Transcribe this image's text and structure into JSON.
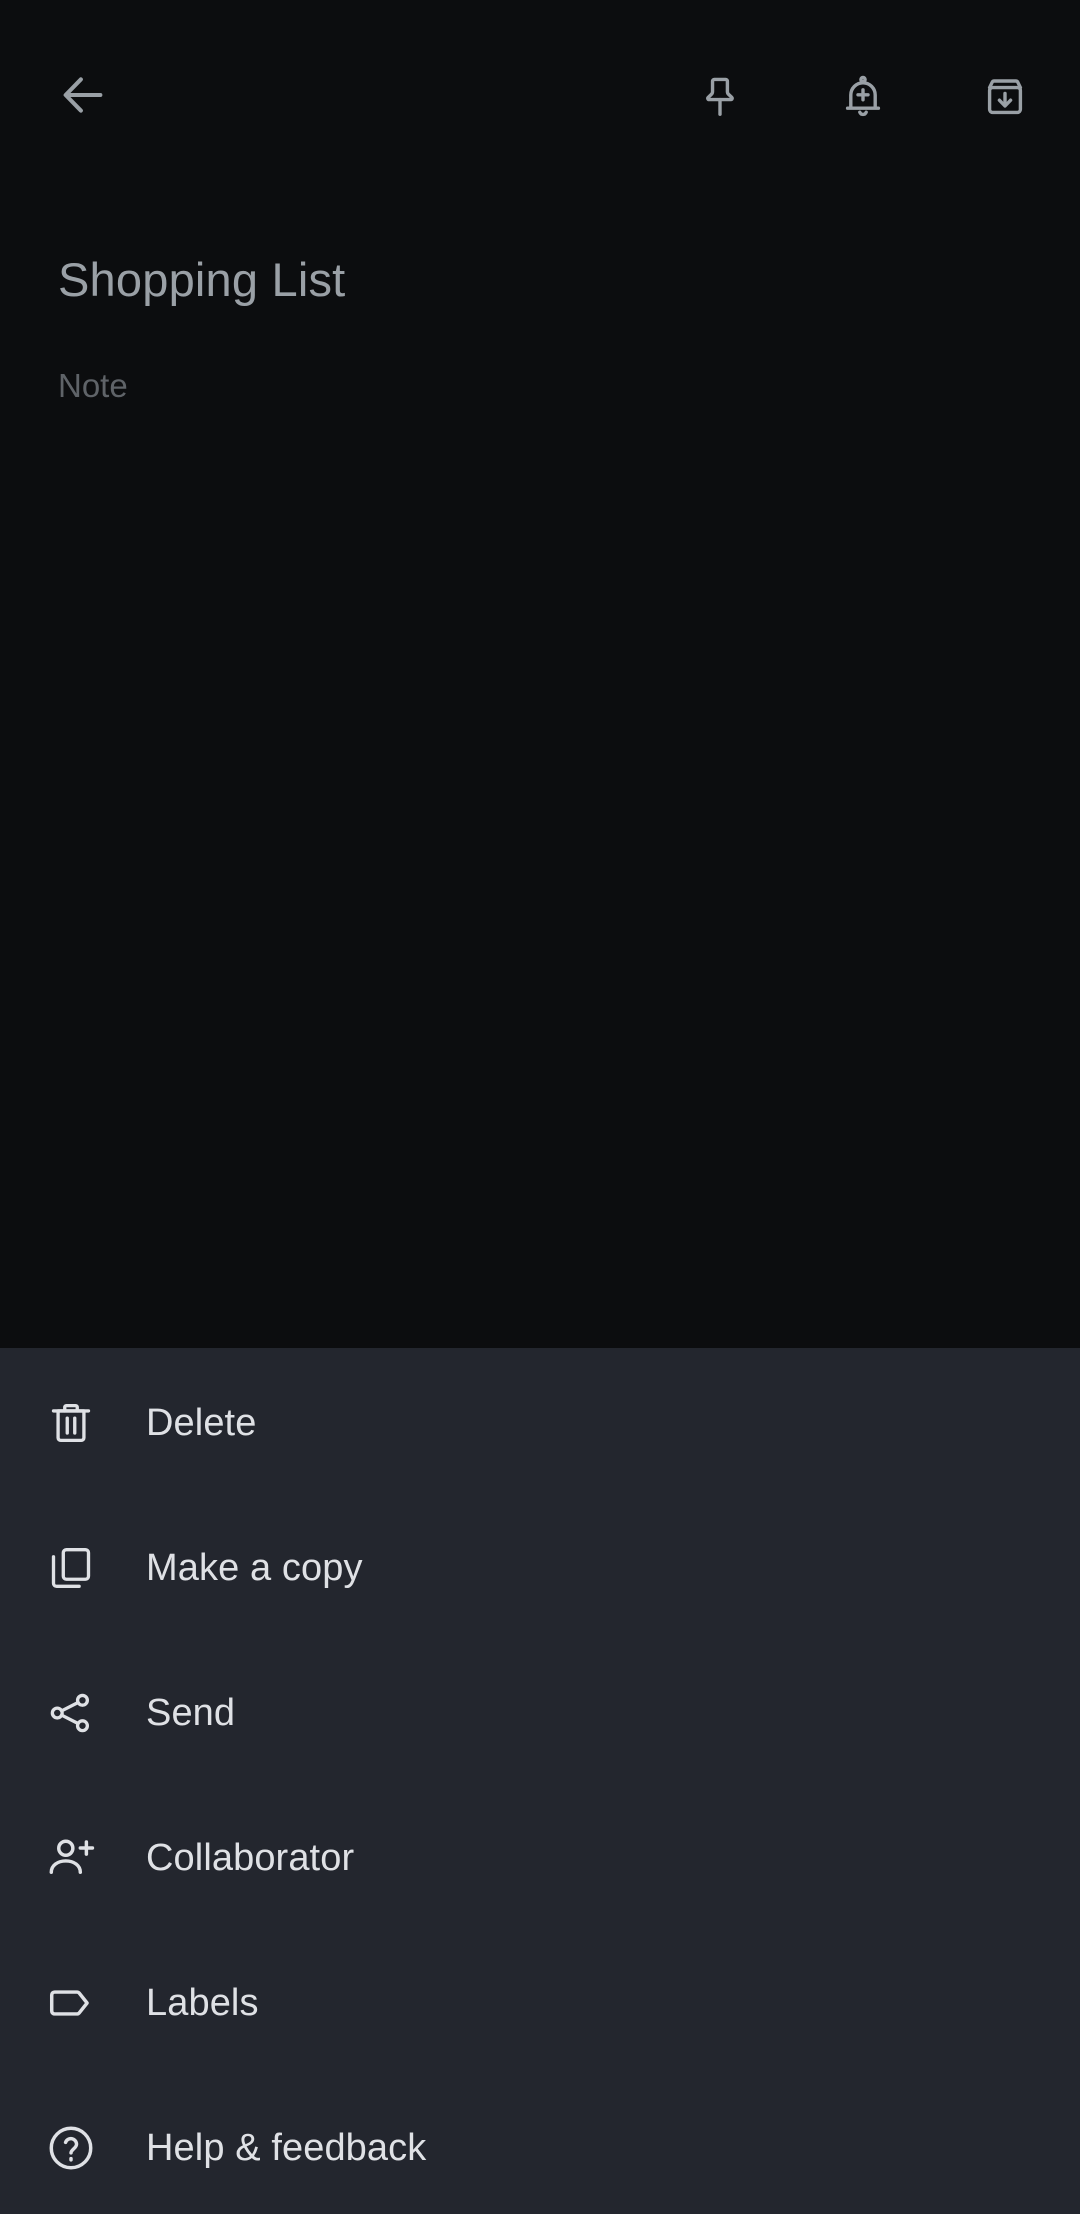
{
  "theme": {
    "note_background": "#0c0d0f",
    "sheet_background": "#23262e",
    "title_color": "#9aa0a6",
    "placeholder_color": "#5f6368",
    "menu_label_color": "#dfe1e5",
    "icon_color": "#9aa0a6",
    "menu_icon_color": "#dfe1e5"
  },
  "appbar": {
    "back": {
      "label": "Back",
      "icon": "arrow-left-icon"
    },
    "actions": [
      {
        "label": "Pin note",
        "icon": "pin-icon"
      },
      {
        "label": "Remind me",
        "icon": "bell-plus-icon"
      },
      {
        "label": "Archive",
        "icon": "archive-down-icon"
      }
    ]
  },
  "note": {
    "title": "Shopping List",
    "body_placeholder": "Note"
  },
  "menu": {
    "items": [
      {
        "label": "Delete",
        "icon": "trash-icon"
      },
      {
        "label": "Make a copy",
        "icon": "copy-icon"
      },
      {
        "label": "Send",
        "icon": "share-icon"
      },
      {
        "label": "Collaborator",
        "icon": "person-add-icon"
      },
      {
        "label": "Labels",
        "icon": "tag-icon"
      },
      {
        "label": "Help & feedback",
        "icon": "help-circle-icon"
      }
    ]
  }
}
